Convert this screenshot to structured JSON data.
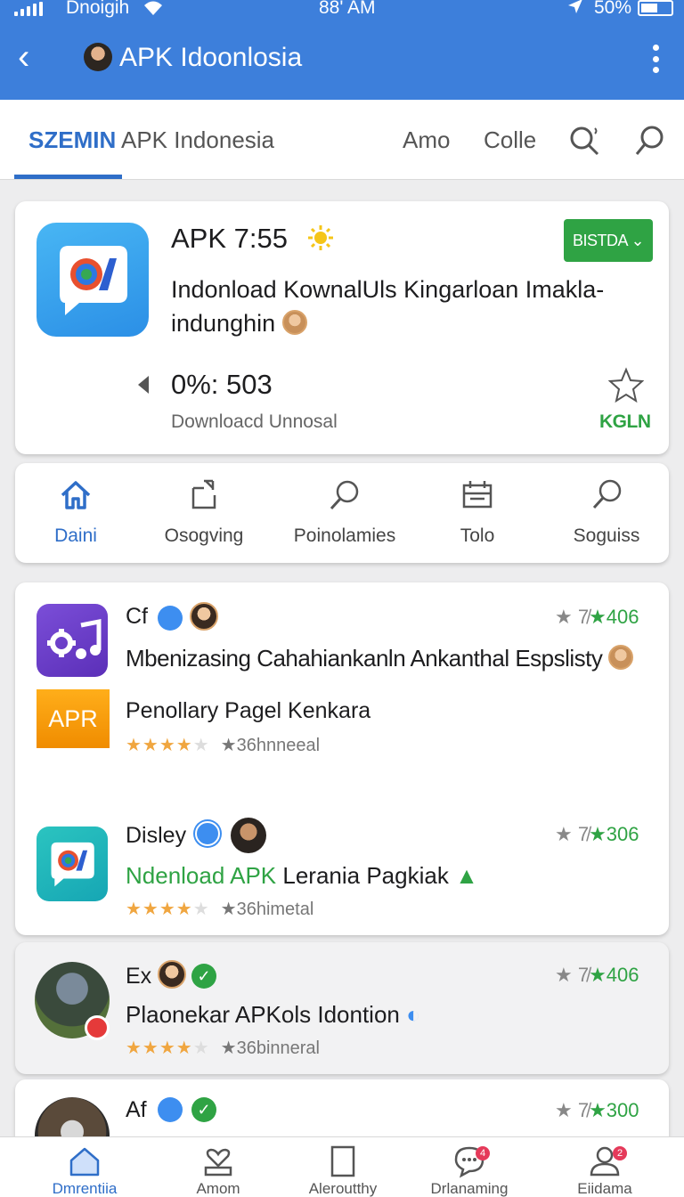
{
  "status_bar": {
    "carrier": "Dnoigih",
    "time": "88' AM",
    "battery": "50%"
  },
  "app_bar": {
    "title": "APK Idoonlosia"
  },
  "tabs": [
    {
      "label": "SZEMIN",
      "active": true
    },
    {
      "label": "APK Indonesia"
    },
    {
      "label": "Amo"
    },
    {
      "label": "Colle"
    }
  ],
  "hero": {
    "title": "APK 7:55",
    "button_label": "BISTDA",
    "description": "Indonload KownalUls Kingarloan Imakla-indunghin",
    "stat": "0%: 503",
    "subtitle": "Downloacd Unnosal",
    "green_label": "KGLN"
  },
  "quick_nav": [
    {
      "label": "Daini",
      "icon": "home-icon",
      "active": true
    },
    {
      "label": "Osogving",
      "icon": "share-icon"
    },
    {
      "label": "Poinolamies",
      "icon": "search-icon"
    },
    {
      "label": "Tolo",
      "icon": "calendar-icon"
    },
    {
      "label": "Soguiss",
      "icon": "search-icon"
    }
  ],
  "list": [
    {
      "name": "Cf",
      "rating_prefix": "★ 7̸",
      "rating": "★406",
      "description": "Mbenizasing Cahahiankanln Ankanthal Espslisty"
    },
    {
      "icon_text": "APR",
      "name": "Penollary Pagel Kenkara",
      "meta": "★36hnneeal"
    },
    {
      "name": "Disley",
      "rating_prefix": "★ 7̸",
      "rating": "★306",
      "description": "Ndenload APK",
      "description_rest": " Lerania Pagkiak",
      "meta": "★36himetal"
    },
    {
      "name": "Ex",
      "rating_prefix": "★ 7̸",
      "rating": "★406",
      "description": "Plaonekar APKols Idontion",
      "meta": "★36binneral"
    },
    {
      "name": "Af",
      "rating_prefix": "★ 7̸",
      "rating": "★300"
    }
  ],
  "bottom_nav": [
    {
      "label": "Dmrentiia",
      "icon": "home-icon",
      "active": true
    },
    {
      "label": "Amom",
      "icon": "heart-tray-icon"
    },
    {
      "label": "Aleroutthy",
      "icon": "bookmark-icon"
    },
    {
      "label": "Drlanaming",
      "icon": "chat-icon",
      "badge": "4"
    },
    {
      "label": "Eiidama",
      "icon": "profile-icon",
      "badge": "2"
    }
  ],
  "colors": {
    "primary": "#3d7fdb",
    "accent": "#2fa344",
    "star": "#f0a640"
  }
}
